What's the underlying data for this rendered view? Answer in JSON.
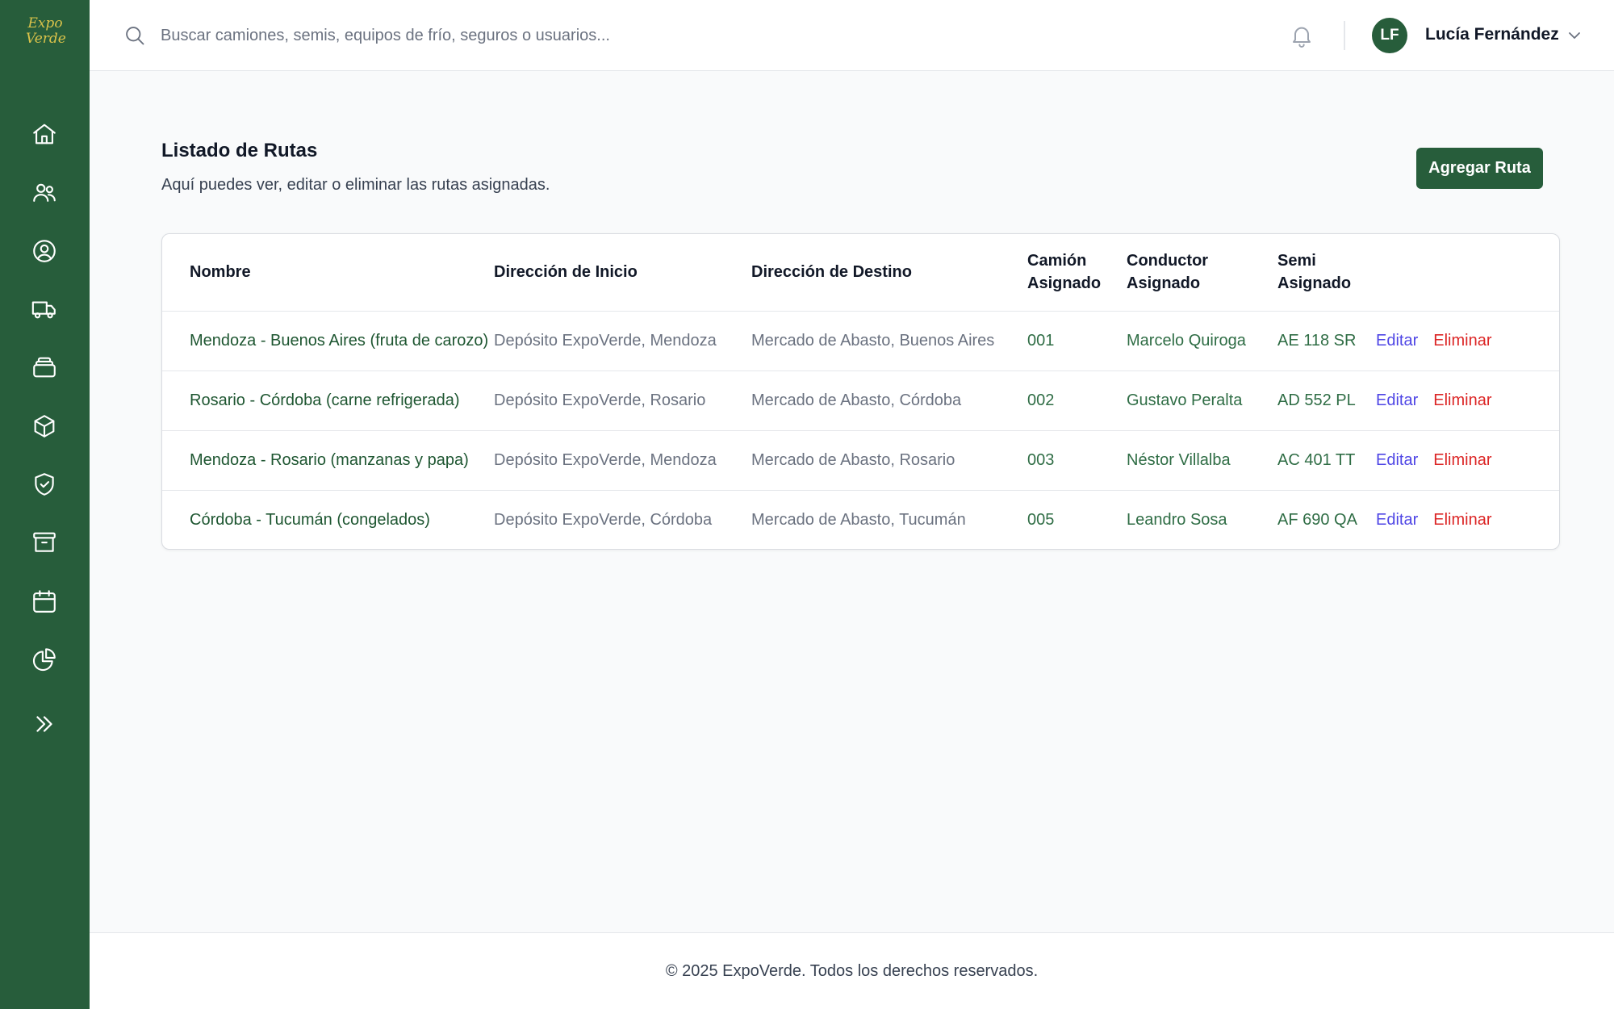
{
  "brand": {
    "logo_line1": "Expo",
    "logo_line2": "Verde",
    "accent": "#275d3b"
  },
  "sidebar": {
    "items": [
      {
        "name": "home",
        "icon": "home-icon"
      },
      {
        "name": "users",
        "icon": "users-icon"
      },
      {
        "name": "profile",
        "icon": "user-circle-icon"
      },
      {
        "name": "trucks",
        "icon": "truck-icon"
      },
      {
        "name": "equipment",
        "icon": "stack-icon"
      },
      {
        "name": "cargo",
        "icon": "cube-icon"
      },
      {
        "name": "insurance",
        "icon": "shield-check-icon"
      },
      {
        "name": "archive",
        "icon": "archive-icon"
      },
      {
        "name": "calendar",
        "icon": "calendar-icon"
      },
      {
        "name": "reports",
        "icon": "pie-chart-icon"
      },
      {
        "name": "expand",
        "icon": "chevrons-right-icon"
      }
    ]
  },
  "header": {
    "search_placeholder": "Buscar camiones, semis, equipos de frío, seguros o usuarios...",
    "user": {
      "initials": "LF",
      "name": "Lucía Fernández"
    }
  },
  "main": {
    "title": "Listado de Rutas",
    "subtitle": "Aquí puedes ver, editar o eliminar las rutas asignadas.",
    "add_button": "Agregar Ruta",
    "columns": [
      "Nombre",
      "Dirección de Inicio",
      "Dirección de Destino",
      "Camión Asignado",
      "Conductor Asignado",
      "Semi Asignado"
    ],
    "edit_label": "Editar",
    "delete_label": "Eliminar",
    "rows": [
      {
        "name": "Mendoza - Buenos Aires (fruta de carozo)",
        "start": "Depósito ExpoVerde, Mendoza",
        "destination": "Mercado de Abasto, Buenos Aires",
        "truck": "001",
        "driver": "Marcelo Quiroga",
        "semi": "AE 118 SR"
      },
      {
        "name": "Rosario - Córdoba (carne refrigerada)",
        "start": "Depósito ExpoVerde, Rosario",
        "destination": "Mercado de Abasto, Córdoba",
        "truck": "002",
        "driver": "Gustavo Peralta",
        "semi": "AD 552 PL"
      },
      {
        "name": "Mendoza - Rosario (manzanas y papa)",
        "start": "Depósito ExpoVerde, Mendoza",
        "destination": "Mercado de Abasto, Rosario",
        "truck": "003",
        "driver": "Néstor Villalba",
        "semi": "AC 401 TT"
      },
      {
        "name": "Córdoba - Tucumán (congelados)",
        "start": "Depósito ExpoVerde, Córdoba",
        "destination": "Mercado de Abasto, Tucumán",
        "truck": "005",
        "driver": "Leandro Sosa",
        "semi": "AF 690 QA"
      }
    ]
  },
  "footer": {
    "text": "© 2025 ExpoVerde. Todos los derechos reservados."
  }
}
